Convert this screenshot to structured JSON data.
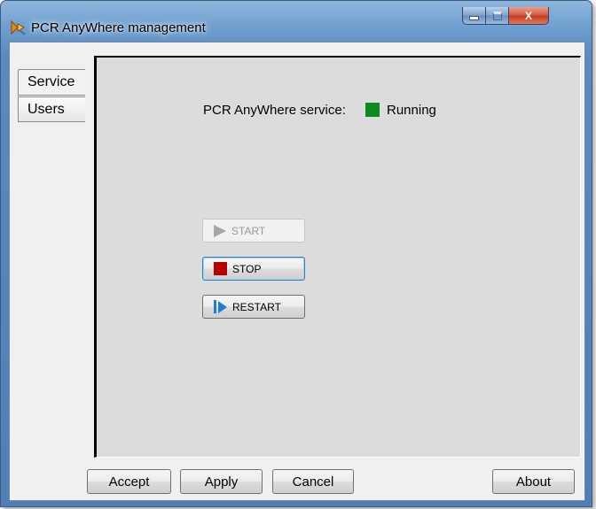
{
  "window": {
    "title": "PCR AnyWhere management",
    "controls": {
      "minimize": "minimize",
      "maximize": "maximize",
      "close": "X"
    }
  },
  "tabs": [
    {
      "label": "Service",
      "selected": true
    },
    {
      "label": "Users",
      "selected": false
    }
  ],
  "service": {
    "status_label": "PCR AnyWhere service:",
    "status_value": "Running",
    "status_color": "#0f8a1e",
    "buttons": {
      "start": {
        "label": "START",
        "enabled": false,
        "icon": "play-icon"
      },
      "stop": {
        "label": "STOP",
        "enabled": true,
        "icon": "stop-icon"
      },
      "restart": {
        "label": "RESTART",
        "enabled": true,
        "icon": "restart-icon"
      }
    }
  },
  "footer": {
    "accept": "Accept",
    "apply": "Apply",
    "cancel": "Cancel",
    "about": "About"
  },
  "colors": {
    "stop_icon": "#b80000",
    "restart_icon": "#1e7fd0",
    "close_button": "#c2391e"
  }
}
